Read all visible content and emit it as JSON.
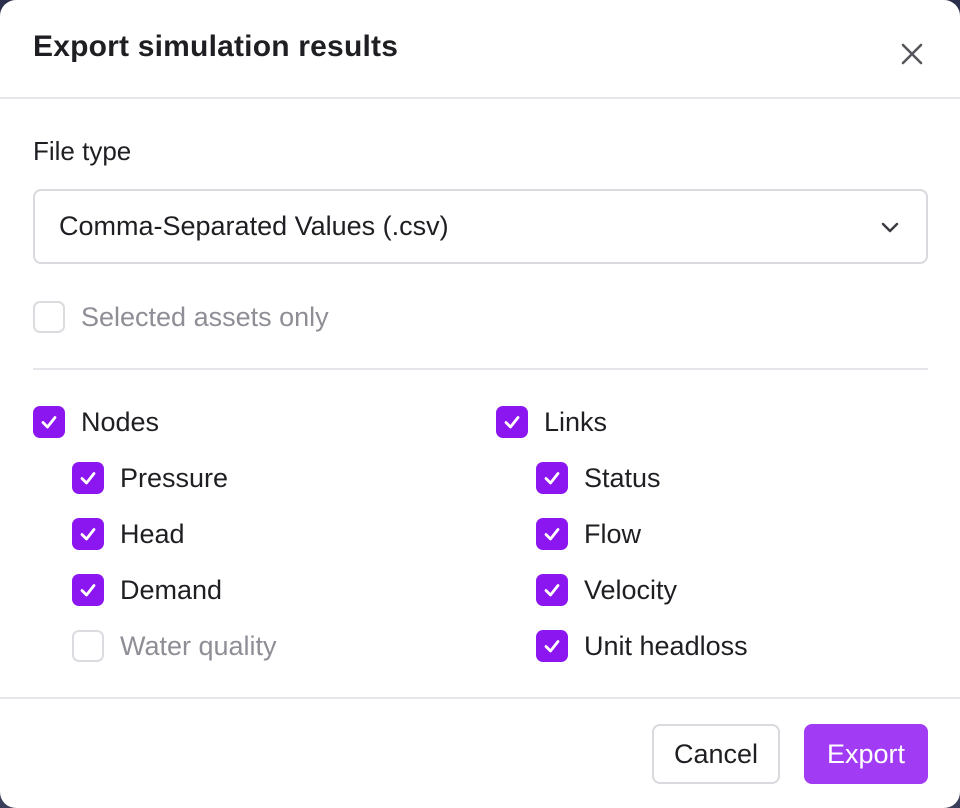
{
  "dialog": {
    "title": "Export simulation results",
    "close_icon": "close-icon"
  },
  "file_type": {
    "label": "File type",
    "selected": "Comma-Separated Values (.csv)",
    "chevron_icon": "chevron-down-icon"
  },
  "selected_assets_only": {
    "label": "Selected assets only",
    "checked": false
  },
  "nodes": {
    "label": "Nodes",
    "checked": true,
    "items": [
      {
        "label": "Pressure",
        "checked": true
      },
      {
        "label": "Head",
        "checked": true
      },
      {
        "label": "Demand",
        "checked": true
      },
      {
        "label": "Water quality",
        "checked": false
      }
    ]
  },
  "links": {
    "label": "Links",
    "checked": true,
    "items": [
      {
        "label": "Status",
        "checked": true
      },
      {
        "label": "Flow",
        "checked": true
      },
      {
        "label": "Velocity",
        "checked": true
      },
      {
        "label": "Unit headloss",
        "checked": true
      }
    ]
  },
  "footer": {
    "cancel_label": "Cancel",
    "export_label": "Export"
  },
  "colors": {
    "accent": "#8c16f0",
    "export_button": "#a13cf4",
    "muted_text": "#8e8e96"
  }
}
